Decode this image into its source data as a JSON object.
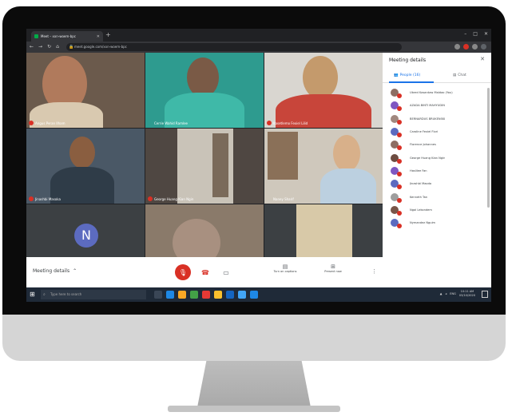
{
  "browser": {
    "tab_title": "Meet – xxn-woem-bpc",
    "url": "meet.google.com/xxn-woem-bpc"
  },
  "tiles": [
    {
      "name": "Angus Peran Ilham",
      "bg": "#6b5a4c"
    },
    {
      "name": "Cerrie Wahid Ramlee",
      "bg": "#2e9b8f"
    },
    {
      "name": "Kasetlemo Fexiel Lilid",
      "bg": "#c8453a"
    },
    {
      "name": "Jinashbi Masoka",
      "bg": "#44505c"
    },
    {
      "name": "George Huang Kian Ngin",
      "bg": "#4f4742"
    },
    {
      "name": "Naney Sharif",
      "bg": "#6b6a5a"
    },
    {
      "name": "",
      "avatar": "N",
      "bg": "#3c4043"
    },
    {
      "name": "",
      "bg": "#8a7a6a"
    },
    {
      "name": "",
      "bg": "#3c4043"
    }
  ],
  "controls": {
    "meeting_details": "Meeting details",
    "captions": "Turn on captions",
    "present": "Present now"
  },
  "panel": {
    "title": "Meeting details",
    "people_tab": "People (16)",
    "chat_tab": "Chat",
    "people": [
      {
        "name": "Ubred Kasantaw Maldao (You)",
        "color": "#8d6e63"
      },
      {
        "name": "AZADA BINTI MAHYUDIN",
        "color": "#7e57c2"
      },
      {
        "name": "BERNARDUS BRUKENSKI",
        "color": "#a1887f"
      },
      {
        "name": "Caroline Fexiel Flori",
        "color": "#5c6bc0"
      },
      {
        "name": "Florence Johannes",
        "color": "#8d6e63"
      },
      {
        "name": "George Huang Kian Ngin",
        "color": "#6d4c41"
      },
      {
        "name": "Haslilee Fan",
        "color": "#7e57c2"
      },
      {
        "name": "Jinashbi Maoda",
        "color": "#5c6bc0"
      },
      {
        "name": "Kenneth Tan",
        "color": "#9e9e9e"
      },
      {
        "name": "Ngai Lekondem",
        "color": "#795548"
      },
      {
        "name": "Nymandez Nguim",
        "color": "#5c6bc0"
      }
    ]
  },
  "taskbar": {
    "search_placeholder": "Type here to search",
    "time": "10:11 AM",
    "date": "03/10/2020",
    "lang": "ENG"
  }
}
